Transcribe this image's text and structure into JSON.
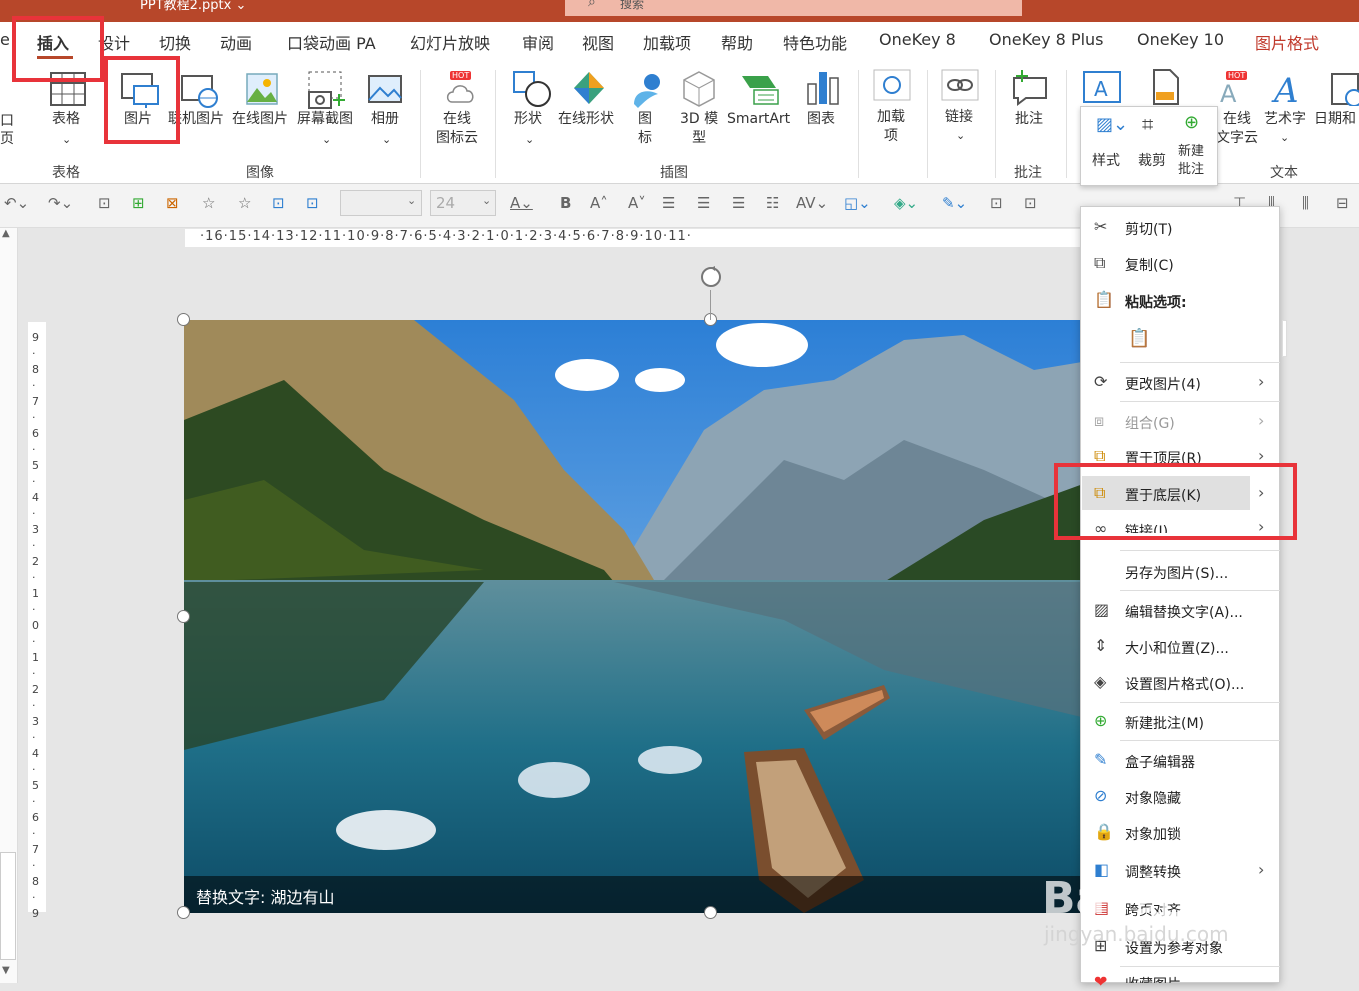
{
  "window": {
    "title": "PPT教程2.pptx ⌄",
    "search_placeholder": "搜索"
  },
  "tabs": [
    "e",
    "插入",
    "设计",
    "切换",
    "动画",
    "口袋动画 PA",
    "幻灯片放映",
    "审阅",
    "视图",
    "加载项",
    "帮助",
    "特色功能",
    "OneKey 8",
    "OneKey 8 Plus",
    "OneKey 10",
    "图片格式"
  ],
  "ribbon": {
    "left_cut": [
      "口",
      "页"
    ],
    "table": "表格",
    "picture": "图片",
    "online_picture": "联机图片",
    "online_picture2": "在线图片",
    "screenshot": "屏幕截图",
    "album": "相册",
    "icon_cloud": "在线\n图标云",
    "shapes": "形状",
    "online_shapes": "在线形状",
    "icons": "图\n标",
    "model3d": "3D 模\n型",
    "smartart": "SmartArt",
    "chart": "图表",
    "addins": "加载\n项",
    "link": "链接",
    "comment": "批注",
    "online_text_cloud": "在线\n文字云",
    "wordart": "艺术字",
    "datetime": "日期和",
    "hot": "HOT",
    "groups": {
      "table": "表格",
      "images": "图像",
      "illustrations": "插图",
      "comments": "批注",
      "text": "文本"
    }
  },
  "mini_toolbar": {
    "style": "样式",
    "crop": "裁剪",
    "new_comment": "新建\n批注"
  },
  "font": {
    "size": "24"
  },
  "ruler": {
    "horizontal": "·16·15·14·13·12·11·10·9·8·7·6·5·4·3·2·1·0·1·2·3·4·5·6·7·8·9·10·11·",
    "vertical": "9·8·7·6·5·4·3·2·1·0·1·2·3·4·5·6·7·8·9"
  },
  "slide": {
    "alt_text": "替换文字: 湖边有山"
  },
  "context_menu": {
    "items": [
      {
        "label": "剪切(T)",
        "icon": "scissors-icon",
        "disabled": false
      },
      {
        "label": "复制(C)",
        "icon": "copy-icon",
        "disabled": false
      },
      {
        "label": "粘贴选项:",
        "icon": "paste-icon",
        "disabled": false
      },
      {
        "label": "更改图片(4)",
        "icon": "change-picture-icon",
        "disabled": false,
        "submenu": true
      },
      {
        "label": "组合(G)",
        "icon": "group-icon",
        "disabled": true,
        "submenu": true
      },
      {
        "label": "置于顶层(R)",
        "icon": "bring-front-icon",
        "disabled": false,
        "submenu": true
      },
      {
        "label": "置于底层(K)",
        "icon": "send-back-icon",
        "disabled": false,
        "submenu": true
      },
      {
        "label": "链接(I)",
        "icon": "link-icon",
        "disabled": false,
        "submenu": true
      },
      {
        "label": "另存为图片(S)...",
        "icon": "",
        "disabled": false
      },
      {
        "label": "编辑替换文字(A)...",
        "icon": "alt-text-icon",
        "disabled": false
      },
      {
        "label": "大小和位置(Z)...",
        "icon": "size-icon",
        "disabled": false
      },
      {
        "label": "设置图片格式(O)...",
        "icon": "format-icon",
        "disabled": false
      },
      {
        "label": "新建批注(M)",
        "icon": "comment-icon",
        "disabled": false
      },
      {
        "label": "盒子编辑器",
        "icon": "edit-icon",
        "disabled": false
      },
      {
        "label": "对象隐藏",
        "icon": "hide-icon",
        "disabled": false
      },
      {
        "label": "对象加锁",
        "icon": "lock-icon",
        "disabled": false
      },
      {
        "label": "调整转换",
        "icon": "convert-icon",
        "disabled": false,
        "submenu": true
      },
      {
        "label": "跨页对齐",
        "icon": "align-icon",
        "disabled": false
      },
      {
        "label": "设置为参考对象",
        "icon": "ref-icon",
        "disabled": false
      },
      {
        "label": "收藏图片",
        "icon": "heart-icon",
        "disabled": false
      }
    ]
  },
  "watermark": {
    "main": "Bai 经验",
    "sub": "jingyan.baidu.com"
  }
}
